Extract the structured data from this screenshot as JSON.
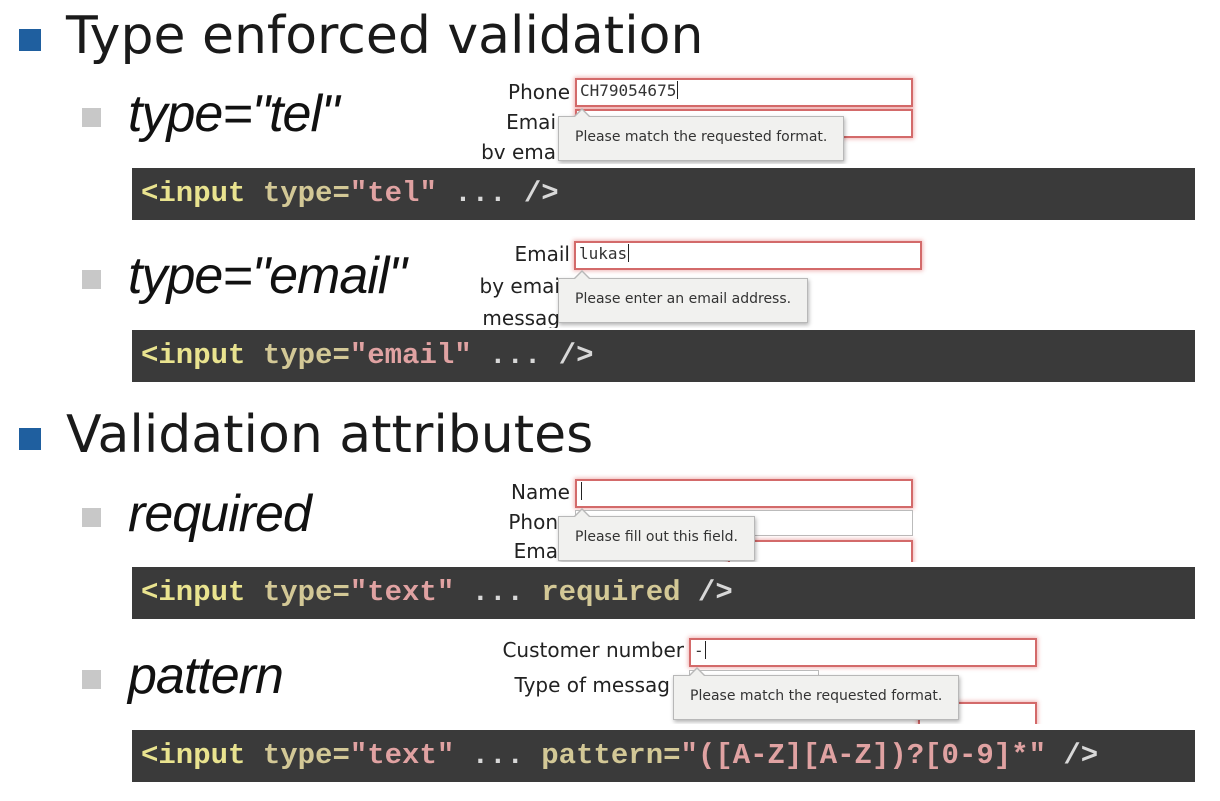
{
  "sections": [
    {
      "title": "Type enforced validation"
    },
    {
      "title": "Validation attributes"
    }
  ],
  "items": [
    {
      "label": "type=\"tel\"",
      "code": {
        "tag": "<input",
        "attr": "type=",
        "value": "\"tel\"",
        "rest": " ... />"
      },
      "shot": {
        "field1_label": "Phone",
        "field1_value": "CH79054675",
        "field2_label": "Emai",
        "field3_label": "bv ema",
        "tooltip": "Please match the requested format."
      }
    },
    {
      "label": "type=\"email\"",
      "code": {
        "tag": "<input",
        "attr": "type=",
        "value": "\"email\"",
        "rest": " ... />"
      },
      "shot": {
        "field1_label": "Email",
        "field1_value": "lukas",
        "field2_label": "by emai",
        "field3_label": "messag",
        "tooltip": "Please enter an email address."
      }
    },
    {
      "label": "required",
      "code": {
        "tag": "<input",
        "attr": "type=",
        "value": "\"text\"",
        "rest_pre": " ... ",
        "extra": "required",
        "rest": " />"
      },
      "shot": {
        "field1_label": "Name",
        "field1_value": "",
        "field2_label": "Phon",
        "field3_label": "Ema",
        "tooltip": "Please fill out this field."
      }
    },
    {
      "label": "pattern",
      "code": {
        "tag": "<input",
        "attr": "type=",
        "value": "\"text\"",
        "rest_pre": " ... ",
        "extra": "pattern=",
        "extra_value": "\"([A-Z][A-Z])?[0-9]*\"",
        "rest": " />"
      },
      "shot": {
        "field1_label": "Customer number",
        "field1_value": "-",
        "field2_label": "Type of messag",
        "tooltip": "Please match the requested format."
      }
    }
  ],
  "colors": {
    "section_bullet": "#1f5f9f",
    "item_bullet": "#c8c8c8",
    "code_bg": "#3a3a3a",
    "code_tag": "#e9e38f",
    "code_attr": "#d3c896",
    "code_string": "#e0a2a2",
    "invalid_border": "#d36a6a"
  }
}
